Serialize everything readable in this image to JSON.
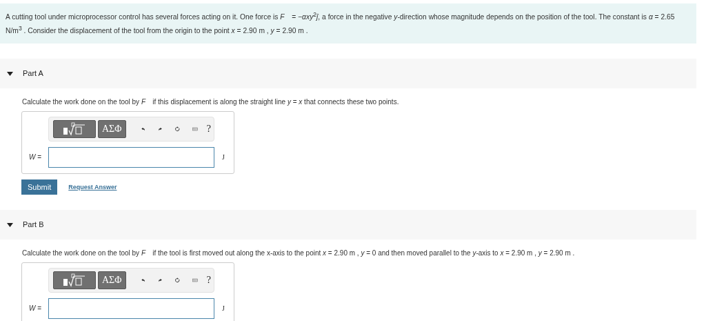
{
  "intro": "A cutting tool under microprocessor control has several forces acting on it. One force is *F⃗* = −*αxy*$^{2}$*ĵ*, a force in the negative *y*-direction whose magnitude depends on the position of the tool. The constant is *α* = 2.65 N/m$^{3}$ . Consider the displacement of the tool from the origin to the point *x* = 2.90 m , *y* = 2.90 m .",
  "parts": [
    {
      "title": "Part A",
      "expanded": true,
      "question": "Calculate the work done on the tool by *F⃗* if this displacement is along the straight line *y* = *x* that connects these two points.",
      "toolbar": {
        "symbols": "ΑΣΦ",
        "help": "?"
      },
      "label": "*W* =",
      "unit": "J",
      "buttons": {
        "submit": "Submit",
        "request": "Request Answer"
      }
    },
    {
      "title": "Part B",
      "expanded": true,
      "question": "Calculate the work done on the tool by *F⃗* if the tool is first moved out along the x-axis to the point *x* = 2.90 m , *y* = 0 and then moved parallel to the *y*-axis to *x* = 2.90 m , *y* = 2.90 m .",
      "toolbar": {
        "symbols": "ΑΣΦ",
        "help": "?"
      },
      "label": "*W* =",
      "unit": "J"
    }
  ]
}
